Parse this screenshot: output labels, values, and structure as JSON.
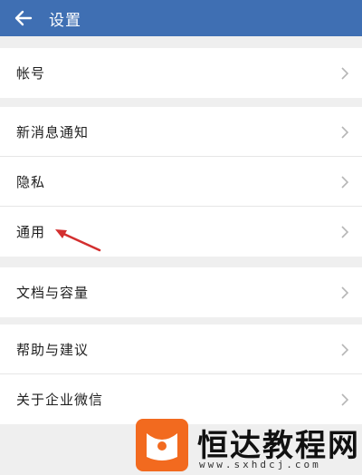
{
  "header": {
    "title": "设置",
    "back_icon": "back-arrow-icon"
  },
  "groups": [
    {
      "items": [
        {
          "label": "帐号"
        }
      ]
    },
    {
      "items": [
        {
          "label": "新消息通知"
        },
        {
          "label": "隐私"
        },
        {
          "label": "通用"
        }
      ]
    },
    {
      "items": [
        {
          "label": "文档与容量"
        }
      ]
    },
    {
      "items": [
        {
          "label": "帮助与建议"
        },
        {
          "label": "关于企业微信"
        }
      ]
    }
  ],
  "annotation": {
    "icon": "red-arrow-icon",
    "color": "#d32f2f"
  },
  "watermark": {
    "brand": "恒达教程网",
    "url": "www.sxhdcj.com",
    "logo_color": "#f26a1f"
  },
  "colors": {
    "header_bg": "#3f6fb3",
    "page_bg": "#efefef",
    "row_bg": "#ffffff"
  }
}
